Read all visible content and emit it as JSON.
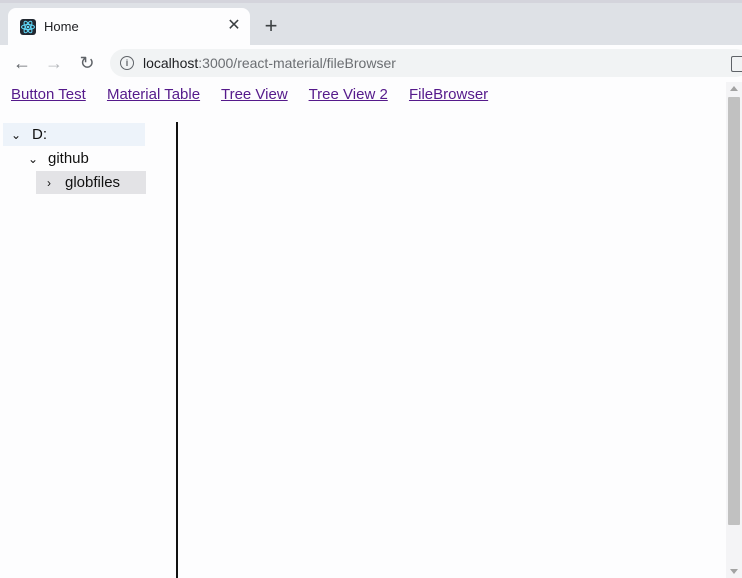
{
  "browser": {
    "tab": {
      "title": "Home",
      "close_glyph": "✕"
    },
    "new_tab_glyph": "+",
    "address": {
      "host": "localhost",
      "path": ":3000/react-material/fileBrowser"
    },
    "icons": {
      "back": "←",
      "forward": "→",
      "reload": "↻",
      "info": "i"
    }
  },
  "page": {
    "nav_links": [
      "Button Test",
      "Material Table",
      "Tree View",
      "Tree View 2",
      "FileBrowser"
    ],
    "tree": [
      {
        "label": "D:",
        "expanded": true,
        "chevron": "⌄"
      },
      {
        "label": "github",
        "expanded": true,
        "chevron": "⌄"
      },
      {
        "label": "globfiles",
        "expanded": false,
        "chevron": "›"
      }
    ]
  },
  "colors": {
    "link_visited": "#551a8b",
    "selected_row": "#edf3fa",
    "focused_row": "#e3e3e6"
  }
}
